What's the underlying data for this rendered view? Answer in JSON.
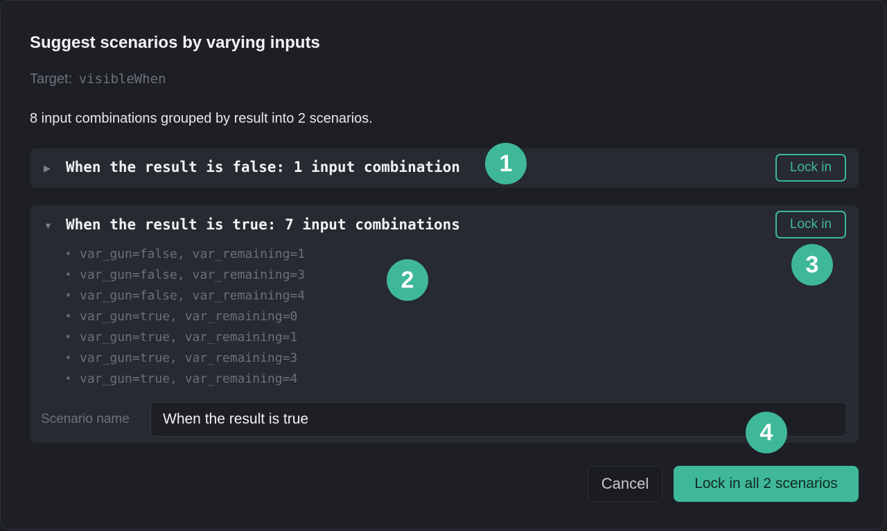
{
  "dialog": {
    "title": "Suggest scenarios by varying inputs",
    "target_label": "Target:",
    "target_value": "visibleWhen",
    "summary": "8 input combinations grouped by result into 2 scenarios."
  },
  "groups": [
    {
      "title": "When the result is false: 1 input combination",
      "expanded": false,
      "chevron": "▶",
      "lock_label": "Lock in"
    },
    {
      "title": "When the result is true: 7 input combinations",
      "expanded": true,
      "chevron": "▼",
      "lock_label": "Lock in",
      "combinations": [
        "var_gun=false, var_remaining=1",
        "var_gun=false, var_remaining=3",
        "var_gun=false, var_remaining=4",
        "var_gun=true, var_remaining=0",
        "var_gun=true, var_remaining=1",
        "var_gun=true, var_remaining=3",
        "var_gun=true, var_remaining=4"
      ],
      "scenario_name_label": "Scenario name",
      "scenario_name_value": "When the result is true"
    }
  ],
  "footer": {
    "cancel_label": "Cancel",
    "lock_all_label": "Lock in all 2 scenarios"
  },
  "markers": [
    "1",
    "2",
    "3",
    "4"
  ],
  "colors": {
    "accent": "#3fb89a",
    "background": "#1d1f25",
    "panel": "#272a31"
  }
}
